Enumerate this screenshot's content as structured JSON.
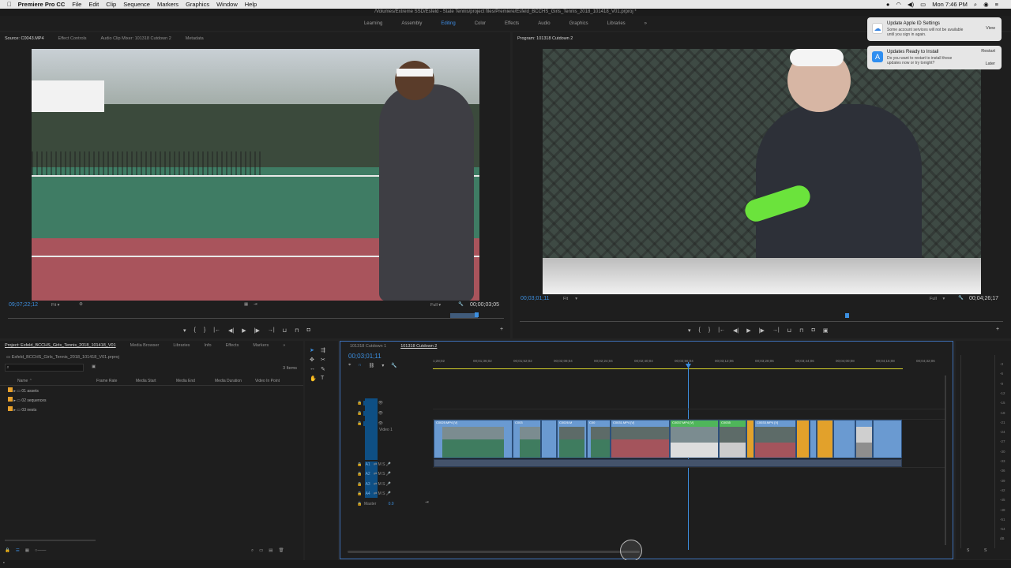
{
  "menubar": {
    "apple": "",
    "app": "Premiere Pro CC",
    "items": [
      "File",
      "Edit",
      "Clip",
      "Sequence",
      "Markers",
      "Graphics",
      "Window",
      "Help"
    ],
    "clock": "Mon 7:46 PM"
  },
  "titlebar": {
    "path": "/Volumes/Extreme SSD/Esfeld - State Tennis/project files/Premiere/Esfeld_BCCHS_Girls_Tennis_2018_101418_V01.prproj *"
  },
  "workspaces": {
    "items": [
      "Learning",
      "Assembly",
      "Editing",
      "Color",
      "Effects",
      "Audio",
      "Graphics",
      "Libraries"
    ],
    "active": "Editing",
    "more": "»"
  },
  "notifications": [
    {
      "title": "Update Apple ID Settings",
      "body": "Some account services will not be available until you sign in again.",
      "buttons": [
        "View"
      ]
    },
    {
      "title": "Updates Ready to Install",
      "body": "Do you want to restart to install these updates now or try tonight?",
      "buttons": [
        "Restart",
        "Later"
      ]
    }
  ],
  "source": {
    "tabs": [
      "Source: C0043.MP4",
      "Effect Controls",
      "Audio Clip Mixer: 101318 Cutdown 2",
      "Metadata"
    ],
    "timecode": "09;07;22;12",
    "fit": "Fit",
    "quality": "Full",
    "duration": "00;00;03;05"
  },
  "program": {
    "tab": "Program: 101318 Cutdown 2",
    "timecode": "00;03;01;11",
    "fit": "Fit",
    "quality": "Full",
    "duration": "00;04;26;17"
  },
  "project": {
    "tabs": [
      "Project: Esfeld_BCCHS_Girls_Tennis_2018_101418_V01",
      "Media Browser",
      "Libraries",
      "Info",
      "Effects",
      "Markers"
    ],
    "file": "Esfeld_BCCHS_Girls_Tennis_2018_101418_V01.prproj",
    "count": "3 Items",
    "columns": [
      "Name",
      "Frame Rate",
      "Media Start",
      "Media End",
      "Media Duration",
      "Video In Point"
    ],
    "bins": [
      "01 assets",
      "02 sequences",
      "03 nests"
    ]
  },
  "timeline": {
    "tabs": [
      "101318 Cutdown 1",
      "101318 Cutdown 2"
    ],
    "timecode": "00;03;01;11",
    "ruler": [
      "1;28;02",
      "00;01;36;02",
      "00;01;52;02",
      "00;02;08;04",
      "00;02;24;04",
      "00;02;40;04",
      "00;02;56;04",
      "00;03;12;06",
      "00;03;28;06",
      "00;03;44;06",
      "00;04;00;08",
      "00;04;16;08",
      "00;04;32;06"
    ],
    "tracks": [
      "V3",
      "V2",
      "V1",
      "A1",
      "A2",
      "A3",
      "A4"
    ],
    "video1": "Video 1",
    "master": "Master",
    "master_val": "0.0",
    "clip_labels": [
      "C0025.MP4 [V]",
      "C003",
      "C0026.M",
      "C00",
      "C0031.MP4 [V]",
      "C0037.MP4 [V]",
      "C0035",
      "C0033.MP4 [V]"
    ]
  },
  "meters": {
    "labels": [
      "-3",
      "-6",
      "-9",
      "-12",
      "-15",
      "-18",
      "-21",
      "-24",
      "-27",
      "-30",
      "-33",
      "-36",
      "-39",
      "-42",
      "-45",
      "-48",
      "-51",
      "-54",
      "dB"
    ],
    "bottom": [
      "S",
      "S"
    ]
  }
}
